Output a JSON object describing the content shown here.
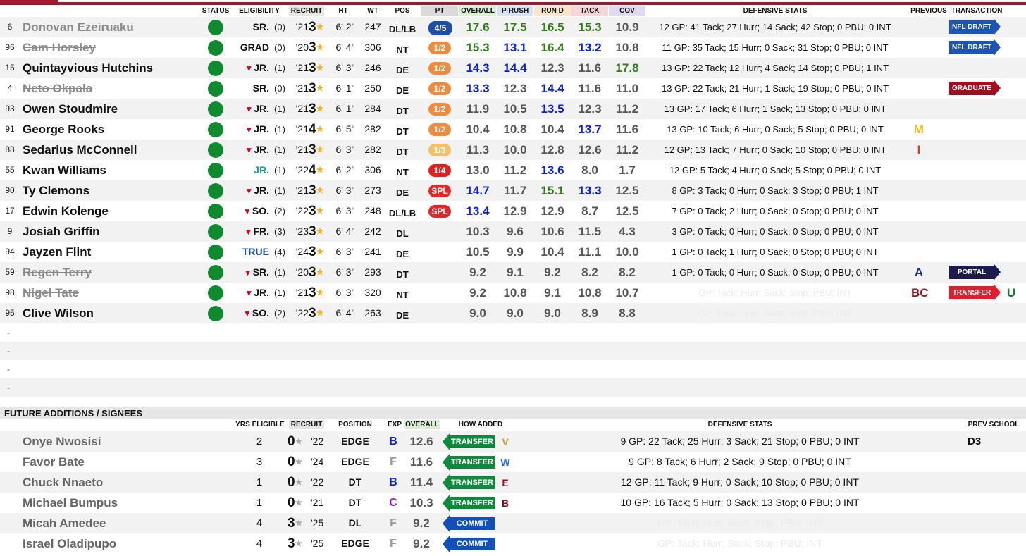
{
  "colors": {
    "accent": "#a3182c",
    "status_active": "#0f8a2e",
    "green": "#2e7d18",
    "blue": "#0a1fd6",
    "draft": "#1d55b5",
    "graduate": "#a01020",
    "portal": "#1f1a4d",
    "transfer": "#e01e2e",
    "transfer_in": "#0e8a3c",
    "commit": "#1050b8"
  },
  "header": {
    "status": "STATUS",
    "eligibility": "ELIGIBILITY",
    "recruit": "RECRUIT",
    "ht": "HT",
    "wt": "WT",
    "pos": "POS",
    "pt": "PT",
    "overall": "OVERALL",
    "prush": "P-RUSH",
    "rund": "RUN D",
    "tack": "TACK",
    "cov": "COV",
    "def_stats": "DEFENSIVE STATS",
    "previous": "PREVIOUS",
    "transaction": "TRANSACTION"
  },
  "roster": [
    {
      "num": "6",
      "name": "Donovan Ezeiruaku",
      "gone": true,
      "cls": "SR.",
      "rs": false,
      "yrs": "(0)",
      "ryr": "'21",
      "stars": "3",
      "pos": "DL/LB",
      "pt": "4/5",
      "ptc": "#1d4fa8",
      "ov": "17.6",
      "pr": "17.5",
      "rd": "16.5",
      "tk": "15.3",
      "cv": "10.9",
      "cols": [
        "g",
        "g",
        "g",
        "g",
        ""
      ],
      "stat": "12 GP: 41 Tack; 27 Hurr; 14 Sack; 42 Stop; 0 PBU; 0 INT",
      "prev": "",
      "tag": "NFL DRAFT",
      "tagc": "#1d55b5"
    },
    {
      "num": "96",
      "name": "Cam Horsley",
      "gone": true,
      "cls": "GRAD",
      "rs": false,
      "yrs": "(0)",
      "ryr": "'20",
      "stars": "3",
      "ht": "6' 4\"",
      "pos": "NT",
      "pt": "1/2",
      "ptc": "#f08a3c",
      "ov": "15.3",
      "pr": "13.1",
      "rd": "16.4",
      "tk": "13.2",
      "cv": "10.8",
      "cols": [
        "g",
        "b",
        "g",
        "b",
        ""
      ],
      "stat": "11 GP: 35 Tack; 15 Hurr; 0 Sack; 31 Stop; 0 PBU; 0 INT",
      "prev": "",
      "tag": "NFL DRAFT",
      "tagc": "#1d55b5"
    },
    {
      "num": "15",
      "name": "Quintayvious Hutchins",
      "gone": false,
      "cls": "JR.",
      "rs": true,
      "yrs": "(1)",
      "ryr": "'21",
      "stars": "3",
      "ht": "6' 3\"",
      "pos": "DE",
      "pt": "1/2",
      "ptc": "#f08a3c",
      "ov": "14.3",
      "pr": "14.4",
      "rd": "12.3",
      "tk": "11.6",
      "cv": "17.8",
      "cols": [
        "b",
        "b",
        "",
        "",
        "g"
      ],
      "stat": "13 GP: 22 Tack; 12 Hurr; 4 Sack; 14 Stop; 0 PBU; 1 INT",
      "prev": "",
      "tag": "",
      "tagc": ""
    },
    {
      "num": "4",
      "name": "Neto Okpala",
      "gone": true,
      "cls": "SR.",
      "rs": false,
      "yrs": "(0)",
      "ryr": "'21",
      "stars": "3",
      "ht": "6' 1\"",
      "pos": "DE",
      "pt": "1/2",
      "ptc": "#f08a3c",
      "ov": "13.3",
      "pr": "12.3",
      "rd": "14.4",
      "tk": "11.6",
      "cv": "11.0",
      "cols": [
        "b",
        "",
        "b",
        "",
        ""
      ],
      "stat": "13 GP: 22 Tack; 21 Hurr; 1 Sack; 19 Stop; 0 PBU; 0 INT",
      "prev": "",
      "tag": "GRADUATE",
      "tagc": "#a01020"
    },
    {
      "num": "93",
      "name": "Owen Stoudmire",
      "gone": false,
      "cls": "JR.",
      "rs": true,
      "yrs": "(1)",
      "ryr": "'21",
      "stars": "3",
      "ht": "6' 1\"",
      "pos": "DT",
      "pt": "1/2",
      "ptc": "#f08a3c",
      "ov": "11.9",
      "pr": "10.5",
      "rd": "13.5",
      "tk": "12.3",
      "cv": "11.2",
      "cols": [
        "",
        "",
        "b",
        "",
        ""
      ],
      "stat": "13 GP: 17 Tack; 6 Hurr; 1 Sack; 13 Stop; 0 PBU; 0 INT",
      "prev": "",
      "tag": "",
      "tagc": ""
    },
    {
      "num": "91",
      "name": "George Rooks",
      "gone": false,
      "cls": "JR.",
      "rs": true,
      "yrs": "(1)",
      "ryr": "'21",
      "stars": "4",
      "ht": "6' 5\"",
      "pos": "DT",
      "pt": "1/2",
      "ptc": "#f08a3c",
      "ov": "10.4",
      "pr": "10.8",
      "rd": "10.4",
      "tk": "13.7",
      "cv": "11.6",
      "cols": [
        "",
        "",
        "",
        "b",
        ""
      ],
      "stat": "13 GP: 10 Tack; 6 Hurr; 0 Sack; 5 Stop; 0 PBU; 0 INT",
      "prev": "M",
      "prevc": "#f0c020",
      "tag": "",
      "tagc": ""
    },
    {
      "num": "88",
      "name": "Sedarius McConnell",
      "gone": false,
      "cls": "JR.",
      "rs": true,
      "yrs": "(1)",
      "ryr": "'21",
      "stars": "3",
      "ht": "6' 3\"",
      "pos": "DT",
      "pt": "1/3",
      "ptc": "#f5c168",
      "ov": "11.3",
      "pr": "10.0",
      "rd": "12.8",
      "tk": "12.6",
      "cv": "11.2",
      "cols": [
        "",
        "",
        "",
        "",
        ""
      ],
      "stat": "12 GP: 13 Tack; 7 Hurr; 0 Sack; 10 Stop; 0 PBU; 0 INT",
      "prev": "I",
      "prevc": "#e2381f",
      "tag": "",
      "tagc": ""
    },
    {
      "num": "55",
      "name": "Kwan Williams",
      "gone": false,
      "cls": "JR.",
      "rs": false,
      "clsc": "teal",
      "yrs": "(1)",
      "ryr": "'22",
      "stars": "4",
      "ht": "6' 2\"",
      "pos": "NT",
      "pt": "1/4",
      "ptc": "#e02020",
      "ov": "13.0",
      "pr": "11.2",
      "rd": "13.6",
      "tk": "8.0",
      "cv": "1.7",
      "cols": [
        "",
        "",
        "b",
        "",
        ""
      ],
      "stat": "12 GP: 5 Tack; 4 Hurr; 0 Sack; 5 Stop; 0 PBU; 0 INT",
      "prev": "",
      "tag": "",
      "tagc": ""
    },
    {
      "num": "90",
      "name": "Ty Clemons",
      "gone": false,
      "cls": "JR.",
      "rs": true,
      "yrs": "(1)",
      "ryr": "'21",
      "stars": "3",
      "ht": "6' 3\"",
      "pos": "DE",
      "pt": "SPL",
      "ptc": "#e02828",
      "ov": "14.7",
      "pr": "11.7",
      "rd": "15.1",
      "tk": "13.3",
      "cv": "12.5",
      "cols": [
        "b",
        "",
        "g",
        "b",
        ""
      ],
      "stat": "8 GP: 3 Tack; 0 Hurr; 0 Sack; 3 Stop; 0 PBU; 1 INT",
      "prev": "",
      "tag": "",
      "tagc": ""
    },
    {
      "num": "17",
      "name": "Edwin Kolenge",
      "gone": false,
      "cls": "SO.",
      "rs": true,
      "yrs": "(2)",
      "ryr": "'22",
      "stars": "3",
      "ht": "6' 3\"",
      "pos": "DL/LB",
      "pt": "SPL",
      "ptc": "#e02828",
      "ov": "13.4",
      "pr": "12.9",
      "rd": "12.9",
      "tk": "8.7",
      "cv": "12.5",
      "cols": [
        "b",
        "",
        "",
        "",
        ""
      ],
      "stat": "7 GP: 0 Tack; 2 Hurr; 0 Sack; 0 Stop; 0 PBU; 0 INT",
      "prev": "",
      "tag": "",
      "tagc": ""
    },
    {
      "num": "9",
      "name": "Josiah Griffin",
      "gone": false,
      "cls": "FR.",
      "rs": true,
      "yrs": "(3)",
      "ryr": "'23",
      "stars": "3",
      "ht": "6' 4\"",
      "pos": "DL",
      "pt": "",
      "ptc": "",
      "ov": "10.3",
      "pr": "9.6",
      "rd": "10.6",
      "tk": "11.5",
      "cv": "4.3",
      "cols": [
        "",
        "",
        "",
        "",
        ""
      ],
      "stat": "3 GP: 0 Tack; 0 Hurr; 0 Sack; 0 Stop; 0 PBU; 0 INT",
      "prev": "",
      "tag": "",
      "tagc": ""
    },
    {
      "num": "94",
      "name": "Jayzen Flint",
      "gone": false,
      "cls": "TRUE",
      "rs": false,
      "clsc": "blue",
      "yrs": "(4)",
      "ryr": "'24",
      "stars": "3",
      "ht": "6' 3\"",
      "pos": "DE",
      "pt": "",
      "ptc": "",
      "ov": "10.5",
      "pr": "9.9",
      "rd": "10.4",
      "tk": "11.1",
      "cv": "10.0",
      "cols": [
        "",
        "",
        "",
        "",
        ""
      ],
      "stat": "1 GP: 0 Tack; 1 Hurr; 0 Sack; 0 Stop; 0 PBU; 0 INT",
      "prev": "",
      "tag": "",
      "tagc": ""
    },
    {
      "num": "59",
      "name": "Regen Terry",
      "gone": true,
      "cls": "SR.",
      "rs": true,
      "yrs": "(1)",
      "ryr": "'20",
      "stars": "3",
      "ht": "6' 3\"",
      "pos": "DT",
      "pt": "",
      "ptc": "",
      "ov": "9.2",
      "pr": "9.1",
      "rd": "9.2",
      "tk": "8.2",
      "cv": "8.2",
      "cols": [
        "",
        "",
        "",
        "",
        ""
      ],
      "stat": "1 GP: 0 Tack; 0 Hurr; 0 Sack; 0 Stop; 0 PBU; 0 INT",
      "prev": "A",
      "prevc": "#1b2f7a",
      "tag": "PORTAL",
      "tagc": "#1f1a4d"
    },
    {
      "num": "98",
      "name": "Nigel Tate",
      "gone": true,
      "cls": "JR.",
      "rs": true,
      "yrs": "(1)",
      "ryr": "'21",
      "stars": "3",
      "ht": "6' 3\"",
      "pos": "NT",
      "pt": "",
      "ptc": "",
      "ov": "9.2",
      "pr": "10.8",
      "rd": "9.1",
      "tk": "10.8",
      "cv": "10.7",
      "cols": [
        "",
        "",
        "",
        "",
        ""
      ],
      "stat": "GP: Tack; Hurr; Sack; Stop; PBU; INT",
      "ghost": true,
      "prev": "BC",
      "prevc": "#8a1a2a",
      "tag": "TRANSFER",
      "tagc": "#e01e2e",
      "next": "U",
      "nextc": "#0e7a3a"
    },
    {
      "num": "95",
      "name": "Clive Wilson",
      "gone": false,
      "cls": "SO.",
      "rs": true,
      "yrs": "(2)",
      "ryr": "'22",
      "stars": "3",
      "ht": "6' 4\"",
      "pos": "DE",
      "pt": "",
      "ptc": "",
      "ov": "9.0",
      "pr": "9.0",
      "rd": "9.0",
      "tk": "8.9",
      "cv": "8.8",
      "cols": [
        "",
        "",
        "",
        "",
        ""
      ],
      "stat": "GP: Tack; Hurr; Sack; Stop; PBU; INT",
      "ghost": true,
      "prev": "",
      "tag": "",
      "tagc": ""
    }
  ],
  "empty_rows": [
    "-",
    "-",
    "-",
    "-"
  ],
  "future": {
    "title": "FUTURE ADDITIONS / SIGNEES",
    "header": {
      "yrs": "YRS ELIGIBLE",
      "recruit": "RECRUIT",
      "position": "POSITION",
      "exp": "EXP",
      "overall": "OVERALL",
      "how": "HOW ADDED",
      "def_stats": "DEFENSIVE STATS",
      "prev_school": "PREV SCHOOL"
    },
    "rows": [
      {
        "name": "Onye Nwosisi",
        "yrs": "2",
        "stars": "0",
        "ryr": "'22",
        "pos": "EDGE",
        "exp": "B",
        "expc": "#0a1fd6",
        "ov": "12.6",
        "how": "TRANSFER",
        "howc": "#0e8a3c",
        "logo": "V",
        "logoc": "#c8a02a",
        "stat": "9 GP: 22 Tack; 25 Hurr; 3 Sack; 21 Stop; 0 PBU; 0 INT",
        "prev": "D3"
      },
      {
        "name": "Favor Bate",
        "yrs": "3",
        "stars": "0",
        "ryr": "'24",
        "pos": "EDGE",
        "exp": "F",
        "expc": "#999999",
        "ov": "11.6",
        "how": "TRANSFER",
        "howc": "#0e8a3c",
        "logo": "W",
        "logoc": "#2a6ad0",
        "stat": "9 GP: 8 Tack; 6 Hurr; 2 Sack; 9 Stop; 0 PBU; 0 INT",
        "prev": ""
      },
      {
        "name": "Chuck Nnaeto",
        "yrs": "1",
        "stars": "0",
        "ryr": "'22",
        "pos": "DT",
        "exp": "B",
        "expc": "#0a1fd6",
        "ov": "11.4",
        "how": "TRANSFER",
        "howc": "#0e8a3c",
        "logo": "E",
        "logoc": "#8a1a2a",
        "stat": "12 GP: 11 Tack; 9 Hurr; 0 Sack; 10 Stop; 0 PBU; 0 INT",
        "prev": ""
      },
      {
        "name": "Michael Bumpus",
        "yrs": "1",
        "stars": "0",
        "ryr": "'21",
        "pos": "DT",
        "exp": "C",
        "expc": "#8a20d0",
        "ov": "10.3",
        "how": "TRANSFER",
        "howc": "#0e8a3c",
        "logo": "B",
        "logoc": "#7a1020",
        "stat": "10 GP: 16 Tack; 5 Hurr; 0 Sack; 13 Stop; 0 PBU; 0 INT",
        "prev": ""
      },
      {
        "name": "Micah Amedee",
        "yrs": "4",
        "stars": "3",
        "ryr": "'25",
        "pos": "DL",
        "exp": "F",
        "expc": "#999999",
        "ov": "9.2",
        "how": "COMMIT",
        "howc": "#1050b8",
        "logo": "",
        "logoc": "",
        "stat": "GP: Tack; Hurr; Sack; Stop; PBU; INT",
        "ghost": true,
        "prev": ""
      },
      {
        "name": "Israel Oladipupo",
        "yrs": "4",
        "stars": "3",
        "ryr": "'25",
        "pos": "EDGE",
        "exp": "F",
        "expc": "#999999",
        "ov": "9.2",
        "how": "COMMIT",
        "howc": "#1050b8",
        "logo": "",
        "logoc": "",
        "stat": "GP: Tack; Hurr; Sack; Stop; PBU; INT",
        "ghost": true,
        "prev": ""
      }
    ]
  }
}
